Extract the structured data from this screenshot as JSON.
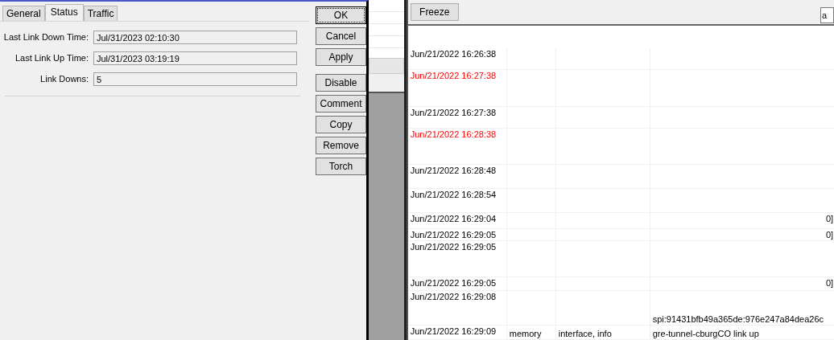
{
  "dialog": {
    "tabs": [
      {
        "label": "General",
        "selected": false
      },
      {
        "label": "Status",
        "selected": true
      },
      {
        "label": "Traffic",
        "selected": false
      }
    ],
    "fields": [
      {
        "label": "Last Link Down Time:",
        "value": "Jul/31/2023 02:10:30"
      },
      {
        "label": "Last Link Up Time:",
        "value": "Jul/31/2023 03:19:19"
      },
      {
        "label": "Link Downs:",
        "value": "5"
      }
    ],
    "main_buttons": [
      {
        "label": "OK",
        "focused": true
      },
      {
        "label": "Cancel",
        "focused": false
      },
      {
        "label": "Apply",
        "focused": false
      }
    ],
    "action_buttons": [
      {
        "label": "Disable",
        "focused": false
      },
      {
        "label": "Comment",
        "focused": false
      },
      {
        "label": "Copy",
        "focused": false
      },
      {
        "label": "Remove",
        "focused": false
      },
      {
        "label": "Torch",
        "focused": false
      }
    ]
  },
  "log": {
    "toolbar": {
      "button": "Freeze",
      "filter_value": "a"
    },
    "rows": [
      {
        "time": "Jun/21/2022 16:26:38",
        "buffer": "",
        "topics": "",
        "message": "",
        "tail": "",
        "color": "#000000"
      },
      {
        "time": "Jun/21/2022 16:27:38",
        "buffer": "",
        "topics": "",
        "message": "",
        "tail": "",
        "color": "#ff0000"
      },
      {
        "time": "Jun/21/2022 16:27:38",
        "buffer": "",
        "topics": "",
        "message": "",
        "tail": "",
        "color": "#000000"
      },
      {
        "time": "Jun/21/2022 16:28:38",
        "buffer": "",
        "topics": "",
        "message": "",
        "tail": "",
        "color": "#ff0000"
      },
      {
        "time": "Jun/21/2022 16:28:48",
        "buffer": "",
        "topics": "",
        "message": "",
        "tail": "",
        "color": "#000000"
      },
      {
        "time": "Jun/21/2022 16:28:54",
        "buffer": "",
        "topics": "",
        "message": "",
        "tail": "",
        "color": "#000000"
      },
      {
        "time": "Jun/21/2022 16:29:04",
        "buffer": "",
        "topics": "",
        "message": "",
        "tail": "0]",
        "color": "#000000"
      },
      {
        "time": "Jun/21/2022 16:29:05",
        "buffer": "",
        "topics": "",
        "message": "",
        "tail": "0]",
        "color": "#000000"
      },
      {
        "time": "Jun/21/2022 16:29:05",
        "buffer": "",
        "topics": "",
        "message": "",
        "tail": "",
        "color": "#000000"
      },
      {
        "time": "Jun/21/2022 16:29:05",
        "buffer": "",
        "topics": "",
        "message": "",
        "tail": "0]",
        "color": "#000000"
      },
      {
        "time": "Jun/21/2022 16:29:08",
        "buffer": "",
        "topics": "",
        "message": "spi:91431bfb49a365de:976e247a84dea26c",
        "tail": "",
        "color": "#000000"
      },
      {
        "time": "Jun/21/2022 16:29:09",
        "buffer": "memory",
        "topics": "interface, info",
        "message": "gre-tunnel-cburgCO link up",
        "tail": "",
        "color": "#000000"
      }
    ]
  }
}
